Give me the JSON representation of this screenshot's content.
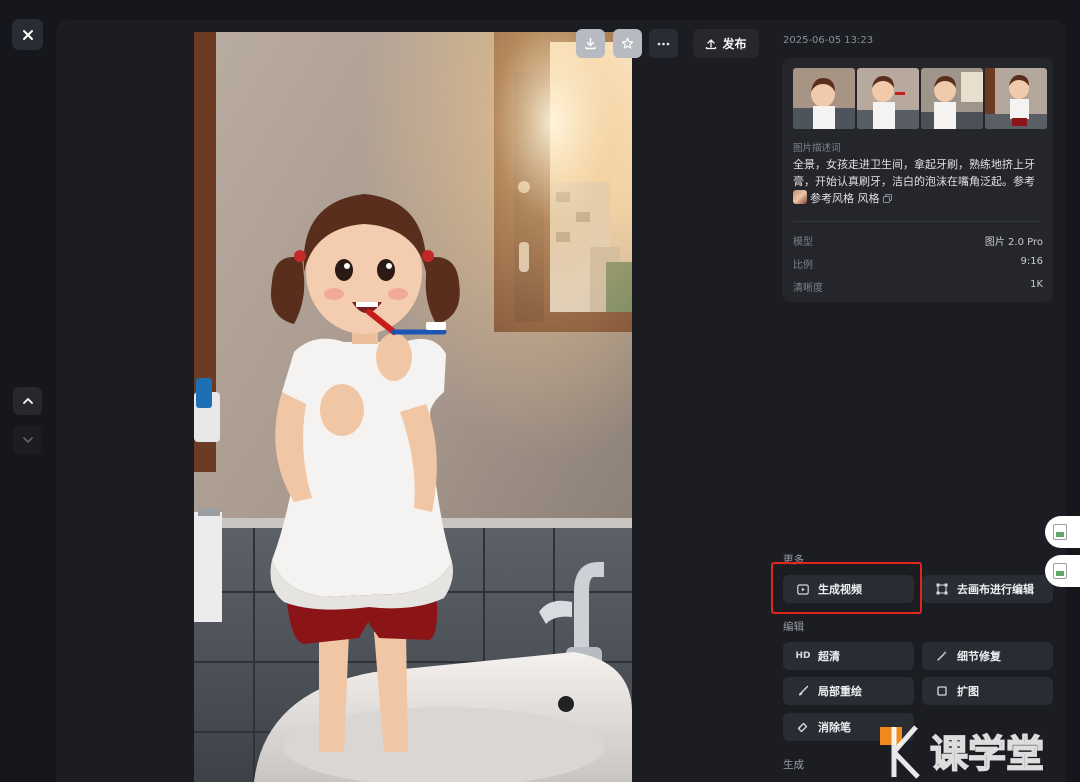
{
  "toolbar": {
    "publish_label": "发布"
  },
  "meta": {
    "timestamp": "2025-06-05 13:23"
  },
  "info": {
    "description_label": "图片描述词",
    "description_text": "全景，女孩走进卫生间，拿起牙刷，熟练地挤上牙膏，开始认真刷牙，洁白的泡沫在嘴角泛起。参考",
    "style_ref_label": "参考风格",
    "style_suffix": "风格",
    "props": [
      {
        "key": "模型",
        "value": "图片 2.0 Pro"
      },
      {
        "key": "比例",
        "value": "9:16"
      },
      {
        "key": "清晰度",
        "value": "1K"
      }
    ]
  },
  "sections": {
    "more_label": "更多",
    "edit_label": "编辑",
    "generate_label": "生成"
  },
  "actions": {
    "generate_video": "生成视频",
    "canvas_edit": "去画布进行编辑",
    "upscale_badge": "HD",
    "upscale": "超清",
    "detail_fix": "细节修复",
    "inpaint": "局部重绘",
    "outpaint": "扩图",
    "eraser": "消除笔"
  },
  "watermark": {
    "text": "课学堂"
  },
  "icons": {
    "close": "close-icon",
    "up": "chevron-up-icon",
    "down": "chevron-down-icon",
    "download": "download-icon",
    "favorite": "star-icon",
    "more": "more-icon",
    "publish": "upload-icon"
  },
  "colors": {
    "highlight": "#e0271f",
    "panel": "#1c1d22",
    "card": "#24262c"
  }
}
